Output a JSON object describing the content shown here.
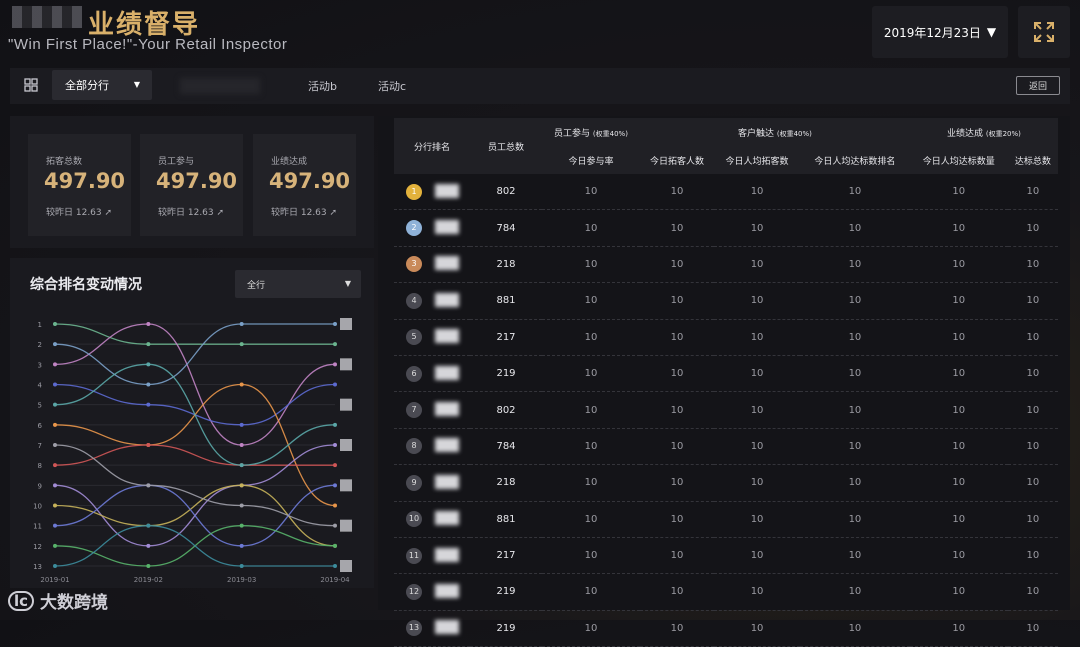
{
  "header": {
    "title": "业绩督导",
    "subtitle": "\"Win First Place!\"-Your Retail Inspector",
    "date": "2019年12月23日"
  },
  "toolbar": {
    "branch_select": "全部分行",
    "tabs": [
      "活动b",
      "活动c"
    ],
    "back_label": "返回"
  },
  "kpis": [
    {
      "label": "拓客总数",
      "value": "497.90",
      "foot": "较昨日 12.63"
    },
    {
      "label": "员工参与",
      "value": "497.90",
      "foot": "较昨日 12.63"
    },
    {
      "label": "业绩达成",
      "value": "497.90",
      "foot": "较昨日 12.63"
    }
  ],
  "chart": {
    "title": "综合排名变动情况",
    "select": "全行"
  },
  "chart_data": {
    "type": "line",
    "categories": [
      "2019-01",
      "2019-02",
      "2019-03",
      "2019-04"
    ],
    "y_ticks": [
      "1",
      "2",
      "3",
      "4",
      "5",
      "6",
      "7",
      "8",
      "9",
      "10",
      "11",
      "12",
      "13"
    ],
    "ylim": [
      1,
      13
    ],
    "y_inverted": true,
    "series": [
      {
        "color": "#6bb58f",
        "values": [
          1,
          2,
          2,
          2
        ]
      },
      {
        "color": "#c184c4",
        "values": [
          3,
          1,
          7,
          3
        ]
      },
      {
        "color": "#7aa0c8",
        "values": [
          2,
          4,
          1,
          1
        ]
      },
      {
        "color": "#5c6ad1",
        "values": [
          4,
          5,
          6,
          4
        ]
      },
      {
        "color": "#e9964a",
        "values": [
          6,
          7,
          4,
          10
        ]
      },
      {
        "color": "#d05656",
        "values": [
          8,
          7,
          8,
          8
        ]
      },
      {
        "color": "#5aa7a7",
        "values": [
          5,
          3,
          8,
          6
        ]
      },
      {
        "color": "#a28cd6",
        "values": [
          9,
          12,
          9,
          7
        ]
      },
      {
        "color": "#c7b35a",
        "values": [
          10,
          11,
          9,
          12
        ]
      },
      {
        "color": "#6d7ad6",
        "values": [
          11,
          9,
          12,
          9
        ]
      },
      {
        "color": "#58b36a",
        "values": [
          12,
          13,
          11,
          12
        ]
      },
      {
        "color": "#3c8c9c",
        "values": [
          13,
          11,
          13,
          13
        ]
      },
      {
        "color": "#9e9ea8",
        "values": [
          7,
          9,
          10,
          11
        ]
      }
    ]
  },
  "table": {
    "headers": {
      "rank": "分行排名",
      "employees": "员工总数",
      "group1": "员工参与",
      "group1_weight": "(权重40%)",
      "group2": "客户触达",
      "group2_weight": "(权重40%)",
      "group3": "业绩达成",
      "group3_weight": "(权重20%)",
      "sub": [
        "今日参与率",
        "今日拓客人数",
        "今日人均拓客数",
        "今日人均达标数排名",
        "今日人均达标数量",
        "达标总数"
      ]
    },
    "rows": [
      {
        "rank": "1",
        "employees": "802",
        "vals": [
          "10",
          "10",
          "10",
          "10",
          "10",
          "10"
        ]
      },
      {
        "rank": "2",
        "employees": "784",
        "vals": [
          "10",
          "10",
          "10",
          "10",
          "10",
          "10"
        ]
      },
      {
        "rank": "3",
        "employees": "218",
        "vals": [
          "10",
          "10",
          "10",
          "10",
          "10",
          "10"
        ]
      },
      {
        "rank": "4",
        "employees": "881",
        "vals": [
          "10",
          "10",
          "10",
          "10",
          "10",
          "10"
        ]
      },
      {
        "rank": "5",
        "employees": "217",
        "vals": [
          "10",
          "10",
          "10",
          "10",
          "10",
          "10"
        ]
      },
      {
        "rank": "6",
        "employees": "219",
        "vals": [
          "10",
          "10",
          "10",
          "10",
          "10",
          "10"
        ]
      },
      {
        "rank": "7",
        "employees": "802",
        "vals": [
          "10",
          "10",
          "10",
          "10",
          "10",
          "10"
        ]
      },
      {
        "rank": "8",
        "employees": "784",
        "vals": [
          "10",
          "10",
          "10",
          "10",
          "10",
          "10"
        ]
      },
      {
        "rank": "9",
        "employees": "218",
        "vals": [
          "10",
          "10",
          "10",
          "10",
          "10",
          "10"
        ]
      },
      {
        "rank": "10",
        "employees": "881",
        "vals": [
          "10",
          "10",
          "10",
          "10",
          "10",
          "10"
        ]
      },
      {
        "rank": "11",
        "employees": "217",
        "vals": [
          "10",
          "10",
          "10",
          "10",
          "10",
          "10"
        ]
      },
      {
        "rank": "12",
        "employees": "219",
        "vals": [
          "10",
          "10",
          "10",
          "10",
          "10",
          "10"
        ]
      },
      {
        "rank": "13",
        "employees": "219",
        "vals": [
          "10",
          "10",
          "10",
          "10",
          "10",
          "10"
        ]
      }
    ]
  },
  "watermark": "大数跨境",
  "colors": {
    "gold": "#d9b06a",
    "medal1": "#e3b23c",
    "medal2": "#8fb2d8",
    "medal3": "#c98a5a"
  }
}
